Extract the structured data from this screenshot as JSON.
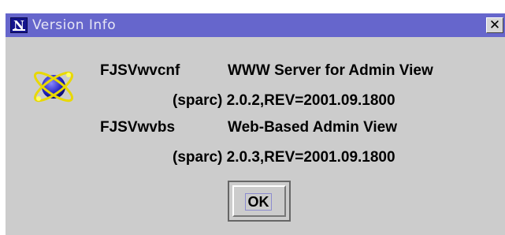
{
  "window": {
    "title": "Version Info",
    "close_glyph": "✕"
  },
  "packages": [
    {
      "name": "FJSVwvcnf",
      "description": "WWW Server for Admin View",
      "version": "(sparc) 2.0.2,REV=2001.09.1800"
    },
    {
      "name": "FJSVwvbs",
      "description": "Web-Based Admin View",
      "version": "(sparc) 2.0.3,REV=2001.09.1800"
    }
  ],
  "ok_label": "OK",
  "icons": {
    "app": "app-n-icon",
    "logo": "atom-globe-icon"
  },
  "colors": {
    "titlebar": "#6666cc",
    "window_bg": "#cccccc"
  }
}
